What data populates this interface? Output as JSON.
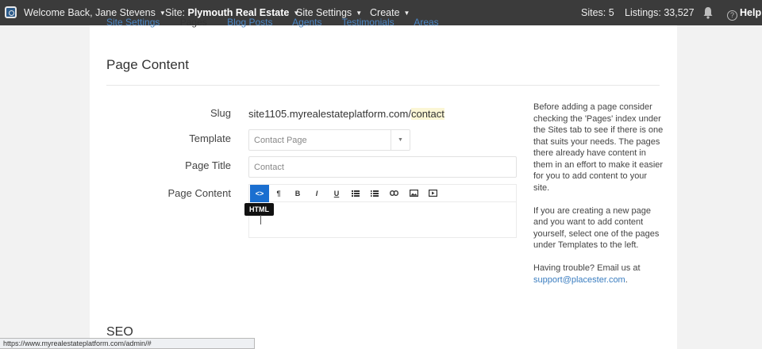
{
  "topbar": {
    "welcome": "Welcome Back, Jane Stevens",
    "site_label": "Site:",
    "site_name": "Plymouth Real Estate",
    "site_settings": "Site Settings",
    "create": "Create",
    "sites": "Sites: 5",
    "listings": "Listings: 33,527",
    "help": "Help",
    "help_icon_glyph": "?"
  },
  "subnav": {
    "items": [
      "Site Settings",
      "Pages",
      "Blog Posts",
      "Agents",
      "Testimonials",
      "Areas"
    ]
  },
  "section_title": "Page Content",
  "form": {
    "slug_label": "Slug",
    "slug_prefix": "site1105.myrealestateplatform.com/",
    "slug_value": "contact",
    "template_label": "Template",
    "template_value": "Contact Page",
    "page_title_label": "Page Title",
    "page_title_placeholder": "Contact",
    "page_content_label": "Page Content"
  },
  "editor": {
    "tooltip": "HTML",
    "buttons": {
      "html": "<>",
      "paragraph": "¶",
      "bold": "B",
      "italic": "I",
      "underline": "U"
    }
  },
  "help": {
    "p1": "Before adding a page consider checking the 'Pages' index under the Sites tab to see if there is one that suits your needs. The pages there already have content in them in an effort to make it easier for you to add content to your site.",
    "p2": "If you are creating a new page and you want to add content yourself, select one of the pages under Templates to the left.",
    "p3_text": "Having trouble? Email us at",
    "p3_link": "support@placester.com",
    "p3_end": "."
  },
  "seo_title": "SEO",
  "status_url": "https://www.myrealestateplatform.com/admin/#",
  "colors": {
    "topbar_bg": "#3b3b3b",
    "accent": "#1b6fd0",
    "link": "#3a7dc0"
  }
}
